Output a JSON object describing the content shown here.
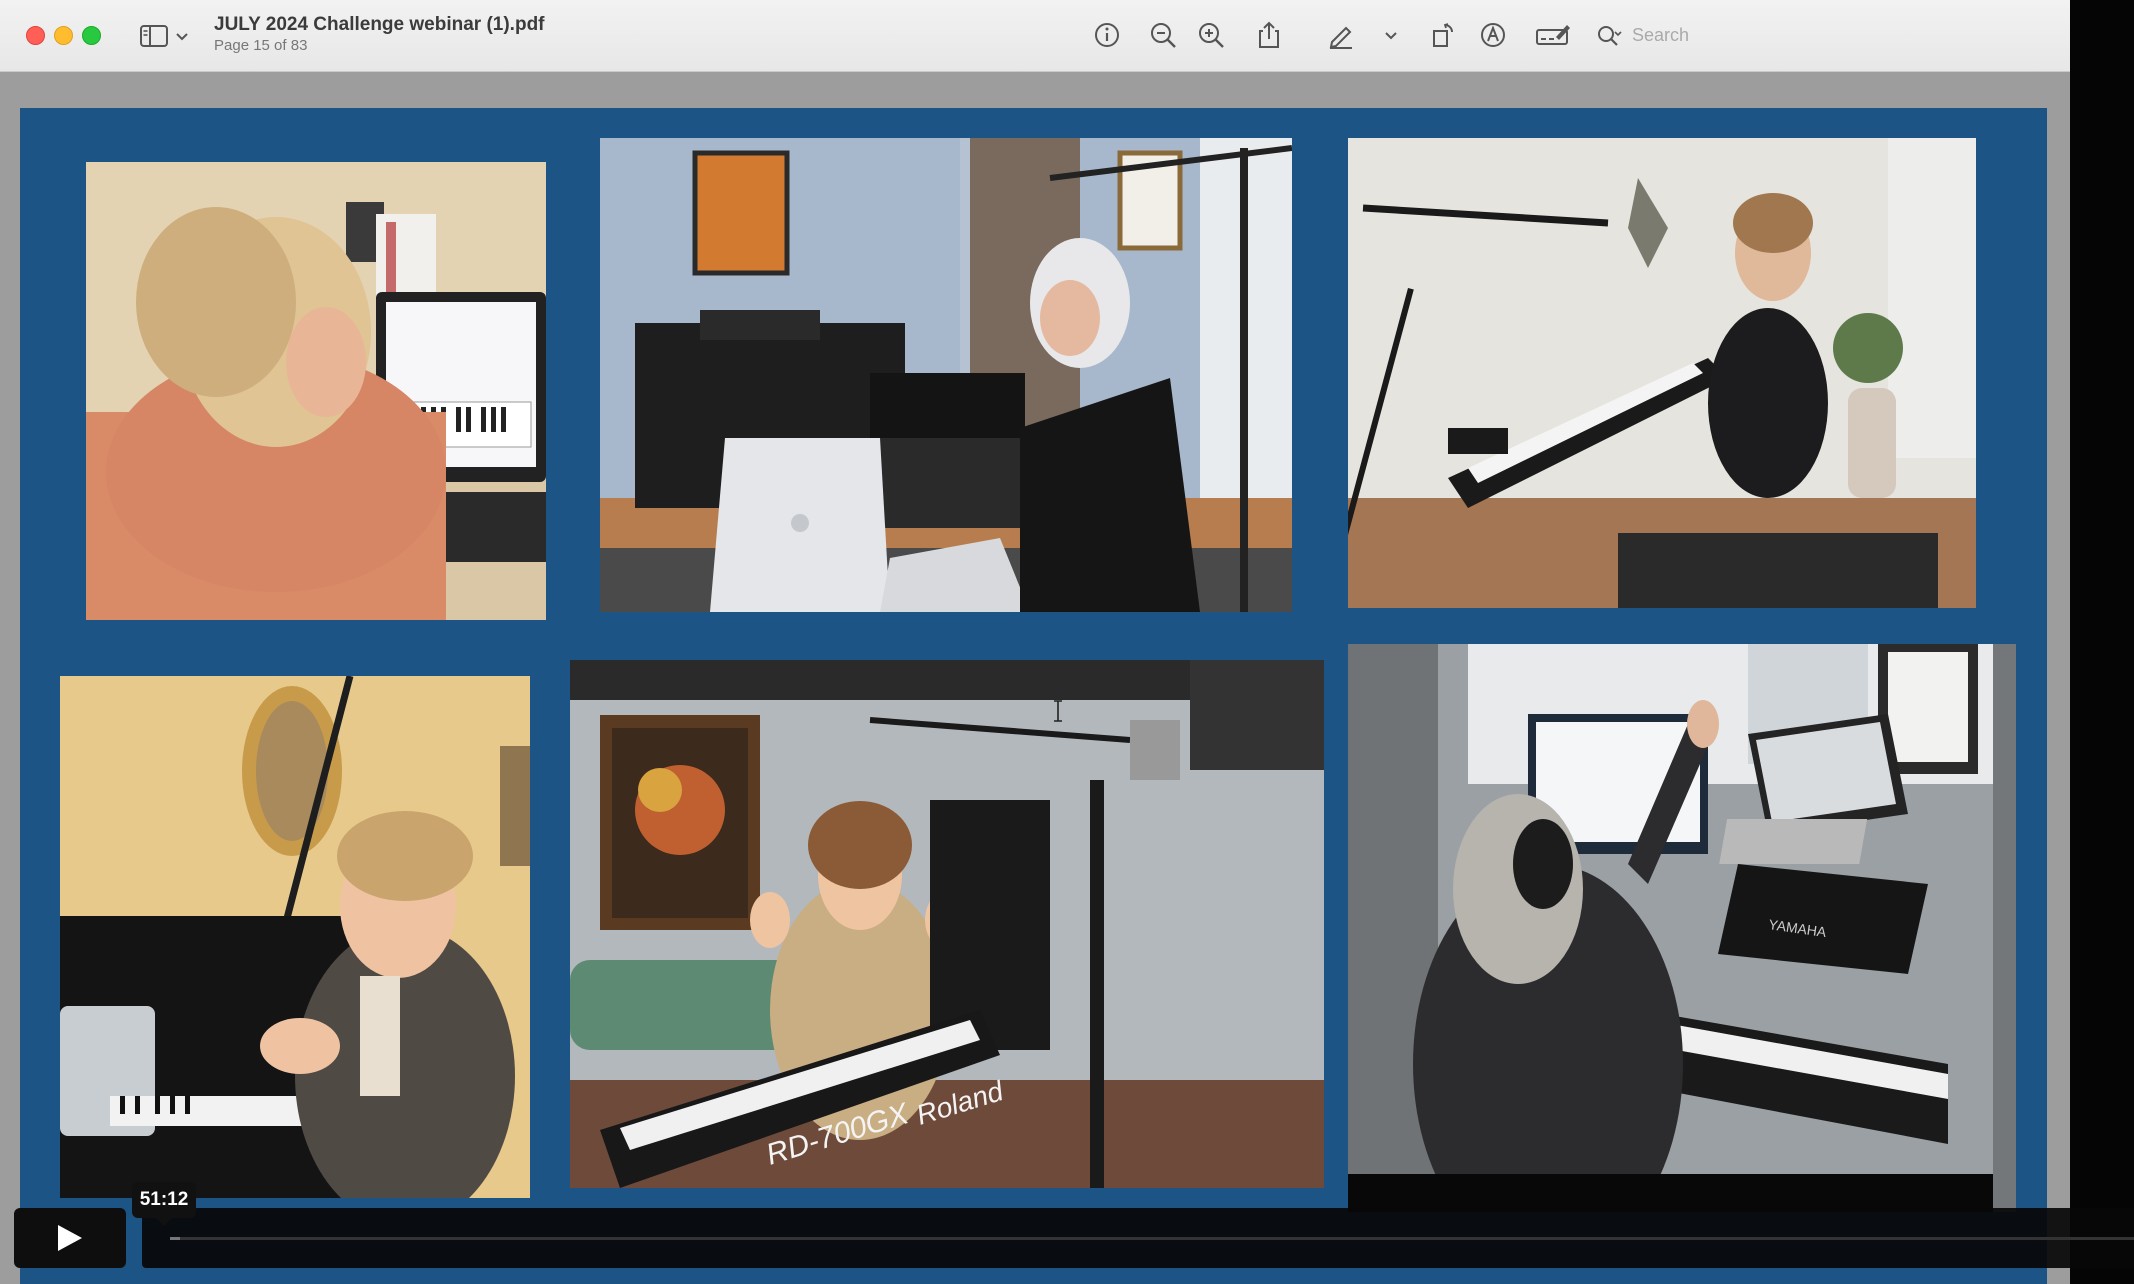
{
  "window": {
    "title": "JULY 2024 Challenge webinar (1).pdf",
    "page_indicator": "Page 15 of 83"
  },
  "toolbar": {
    "icons": [
      "info-icon",
      "zoom-out-icon",
      "zoom-in-icon",
      "share-icon",
      "markup-pen-icon",
      "chevron-down-icon",
      "rotate-icon",
      "annotate-icon",
      "signature-icon"
    ],
    "search_placeholder": "Search"
  },
  "page": {
    "background_color": "#1d5486",
    "photos": [
      "photo-woman-at-computer-keyboard",
      "photo-woman-at-digital-piano-with-laptop",
      "photo-woman-at-stage-piano",
      "photo-woman-clapping-at-piano",
      "photo-woman-waving-at-roland-keyboard",
      "photo-woman-conducting-at-yamaha-piano"
    ],
    "keyboard_brand_text": [
      "RD-700GX",
      "Roland"
    ],
    "piano_brand_text": "YAMAHA"
  },
  "video": {
    "current_time": "51:12",
    "progress_fraction": 0.005
  }
}
